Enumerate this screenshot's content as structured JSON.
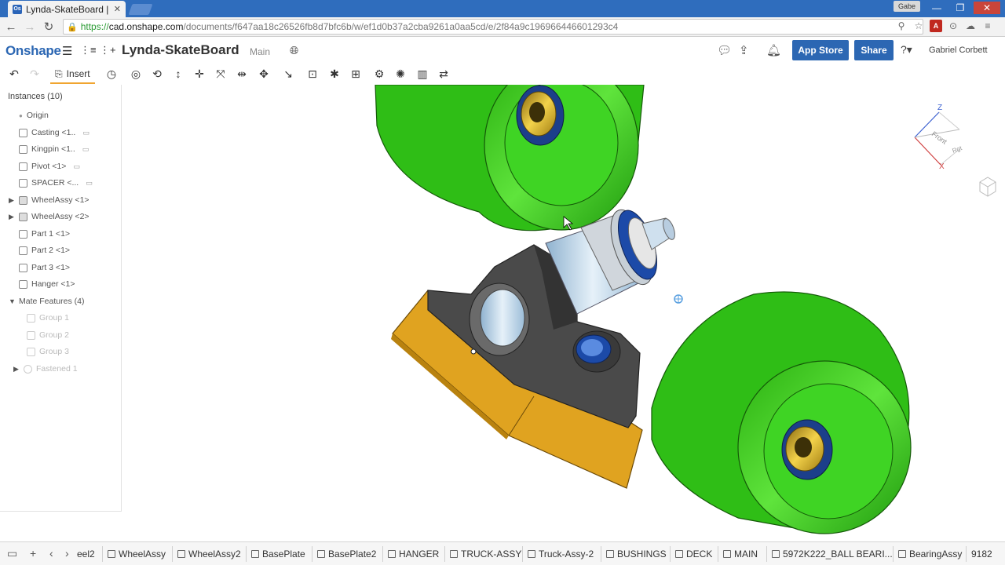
{
  "browser": {
    "tab_title": "Lynda-SkateBoard |",
    "favicon_text": "Os",
    "profile_name": "Gabe",
    "url_scheme": "https://",
    "url_host": "cad.onshape.com",
    "url_path": "/documents/f647aa18c26526fb8d7bfc6b/w/ef1d0b37a2cba9261a0aa5cd/e/2f84a9c196966446601293c4"
  },
  "header": {
    "logo": "Onshape",
    "document_name": "Lynda-SkateBoard",
    "branch": "Main",
    "app_store_label": "App Store",
    "share_label": "Share",
    "user_name": "Gabriel Corbett"
  },
  "toolbar": {
    "insert_label": "Insert"
  },
  "instances": {
    "title": "Instances (10)",
    "items": [
      {
        "label": "Origin",
        "tail": ""
      },
      {
        "label": "Casting <1..",
        "tail": "▭"
      },
      {
        "label": "Kingpin <1..",
        "tail": "▭"
      },
      {
        "label": "Pivot <1>",
        "tail": "▭"
      },
      {
        "label": "SPACER <...",
        "tail": "▭"
      },
      {
        "label": "WheelAssy <1>",
        "tail": ""
      },
      {
        "label": "WheelAssy <2>",
        "tail": ""
      },
      {
        "label": "Part 1 <1>",
        "tail": ""
      },
      {
        "label": "Part 2 <1>",
        "tail": ""
      },
      {
        "label": "Part 3 <1>",
        "tail": ""
      },
      {
        "label": "Hanger <1>",
        "tail": ""
      }
    ],
    "mate_title": "Mate Features (4)",
    "mates": [
      {
        "label": "Group 1"
      },
      {
        "label": "Group 2"
      },
      {
        "label": "Group 3"
      },
      {
        "label": "Fastened 1"
      }
    ]
  },
  "view_cube": {
    "z": "Z",
    "x": "X",
    "front": "Front",
    "right": "Rgt"
  },
  "bottom_tabs": [
    "eel2",
    "WheelAssy",
    "WheelAssy2",
    "BasePlate",
    "BasePlate2",
    "HANGER",
    "TRUCK-ASSY",
    "Truck-Assy-2",
    "BUSHINGS",
    "DECK",
    "MAIN",
    "5972K222_BALL BEARI...",
    "BearingAssy",
    "9182"
  ],
  "colors": {
    "brand_blue": "#2c67b3",
    "wheel_green": "#36c81e",
    "base_yellow": "#e0a320",
    "hanger_gray": "#4a4a4a"
  }
}
